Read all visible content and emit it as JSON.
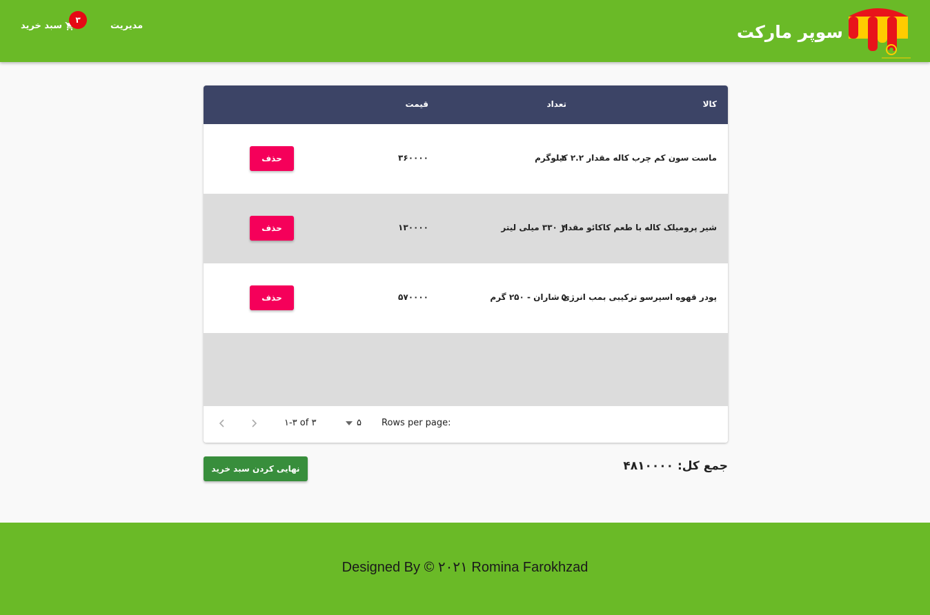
{
  "header": {
    "brand_title": "سوپر مارکت",
    "nav": {
      "cart_label": "سبد خرید",
      "cart_count": "۳",
      "admin_label": "مدیریت"
    }
  },
  "table": {
    "columns": {
      "product": "کالا",
      "price": "قیمت",
      "quantity": "تعداد"
    },
    "rows": [
      {
        "name": "ماست سون کم چرب کاله مقدار ۲.۲ کیلوگرم",
        "price": "۳۶۰۰۰۰",
        "quantity": "۴",
        "delete_label": "حذف"
      },
      {
        "name": "شیر پروميلک کاله با طعم کاکائو مقدار ۳۳۰ میلی لیتر",
        "price": "۱۳۰۰۰۰",
        "quantity": "۴",
        "delete_label": "حذف"
      },
      {
        "name": "پودر قهوه اسپرسو ترکیبی بمب انرژی شاران - ۲۵۰ گرم",
        "price": "۵۷۰۰۰۰",
        "quantity": "۵",
        "delete_label": "حذف"
      }
    ],
    "pagination": {
      "rows_per_page_label": "Rows per page:",
      "rows_per_page_value": "۵",
      "range_text": "۱-۳ of ۳"
    }
  },
  "summary": {
    "total_label": "جمع کل:",
    "total_value": "۴۸۱۰۰۰۰",
    "checkout_label": "نهایی کردن سبد خرید"
  },
  "footer": {
    "text": "Designed By © ۲۰۲۱ Romina Farokhzad"
  },
  "colors": {
    "header_bg": "#6aba27",
    "table_header_bg": "#3c4466",
    "delete_button": "#f5005a",
    "checkout_button": "#388e3c",
    "badge": "#e50914"
  }
}
